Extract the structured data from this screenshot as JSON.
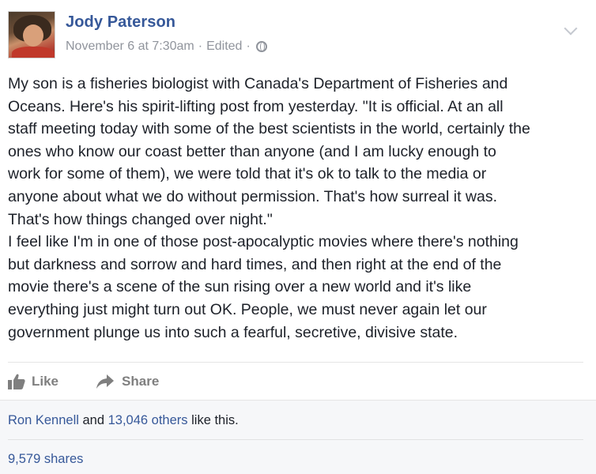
{
  "post": {
    "author": "Jody Paterson",
    "timestamp": "November 6 at 7:30am",
    "edited_label": "Edited",
    "separator": "·",
    "privacy_icon": "globe-icon",
    "menu_icon": "chevron-down-icon",
    "body": "My son is a fisheries biologist with Canada's Department of Fisheries and\nOceans. Here's his spirit-lifting post from yesterday. \"It is official. At an all\nstaff meeting today with some of the best scientists in the world, certainly the\nones who know our coast better than anyone (and I am lucky enough to\nwork for some of them), we were told that it's ok to talk to the media or\nanyone about what we do without permission. That's how surreal it was.\nThat's how things changed over night.\"\nI feel like I'm in one of those post-apocalyptic movies where there's nothing\nbut darkness and sorrow and hard times, and then right at the end of the\nmovie there's a scene of the sun rising over a new world and it's like\neverything just might turn out OK. People, we must never again let our\ngovernment plunge us into such a fearful, secretive, divisive state."
  },
  "actions": {
    "like_label": "Like",
    "like_icon": "thumbs-up-icon",
    "share_label": "Share",
    "share_icon": "share-arrow-icon"
  },
  "summary": {
    "liker_name": "Ron Kennell",
    "and_text": " and ",
    "others_count": "13,046 others",
    "like_suffix": " like this.",
    "shares": "9,579 shares"
  },
  "colors": {
    "link": "#365899",
    "text": "#1d2129",
    "meta": "#90949c",
    "action": "#7f7f7f",
    "summary_bg": "#f6f7f9"
  }
}
